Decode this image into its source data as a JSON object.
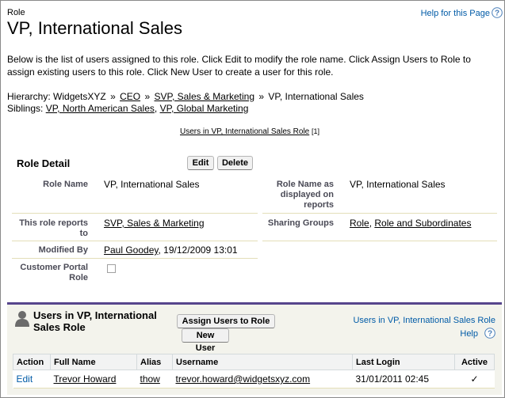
{
  "header": {
    "eyebrow": "Role",
    "title": "VP, International Sales",
    "help_link": "Help for this Page"
  },
  "description": "Below is the list of users assigned to this role. Click Edit to modify the role name. Click Assign Users to Role to assign existing users to this role. Click New User to create a user for this role.",
  "hierarchy": {
    "label": "Hierarchy:",
    "items": [
      "WidgetsXYZ",
      "CEO",
      "SVP, Sales & Marketing",
      "VP, International Sales"
    ],
    "separator": "»"
  },
  "siblings": {
    "label": "Siblings:",
    "items": [
      "VP, North American Sales",
      "VP, Global Marketing"
    ]
  },
  "top_related_link": {
    "label": "Users in VP, International Sales Role",
    "count": "[1]"
  },
  "detail": {
    "title": "Role Detail",
    "edit_label": "Edit",
    "delete_label": "Delete",
    "fields": {
      "role_name_label": "Role Name",
      "role_name_value": "VP, International Sales",
      "display_name_label": "Role Name as displayed on reports",
      "display_name_value": "VP, International Sales",
      "reports_to_label": "This role reports to",
      "reports_to_value": "SVP, Sales & Marketing",
      "sharing_label": "Sharing Groups",
      "sharing_value_1": "Role",
      "sharing_value_2": "Role and Subordinates",
      "modified_label": "Modified By",
      "modified_user": "Paul Goodey",
      "modified_date": ", 19/12/2009 13:01",
      "portal_label": "Customer Portal Role",
      "portal_checked": false
    }
  },
  "users_list": {
    "title": "Users in VP, International Sales Role",
    "assign_label": "Assign Users to Role",
    "new_user_label": "New User",
    "right_link": "Users in VP, International Sales Role",
    "help_label": "Help",
    "columns": [
      "Action",
      "Full Name",
      "Alias",
      "Username",
      "Last Login",
      "Active"
    ],
    "rows": [
      {
        "action": "Edit",
        "full_name": "Trevor Howard",
        "alias": "thow",
        "username": "trevor.howard@widgetsxyz.com",
        "last_login": "31/01/2011 02:45",
        "active": "✓"
      }
    ]
  },
  "colors": {
    "accent": "#56458c",
    "link_blue": "#015ba7",
    "row_line": "#e3deb8",
    "section_bg": "#f3f3ec"
  }
}
